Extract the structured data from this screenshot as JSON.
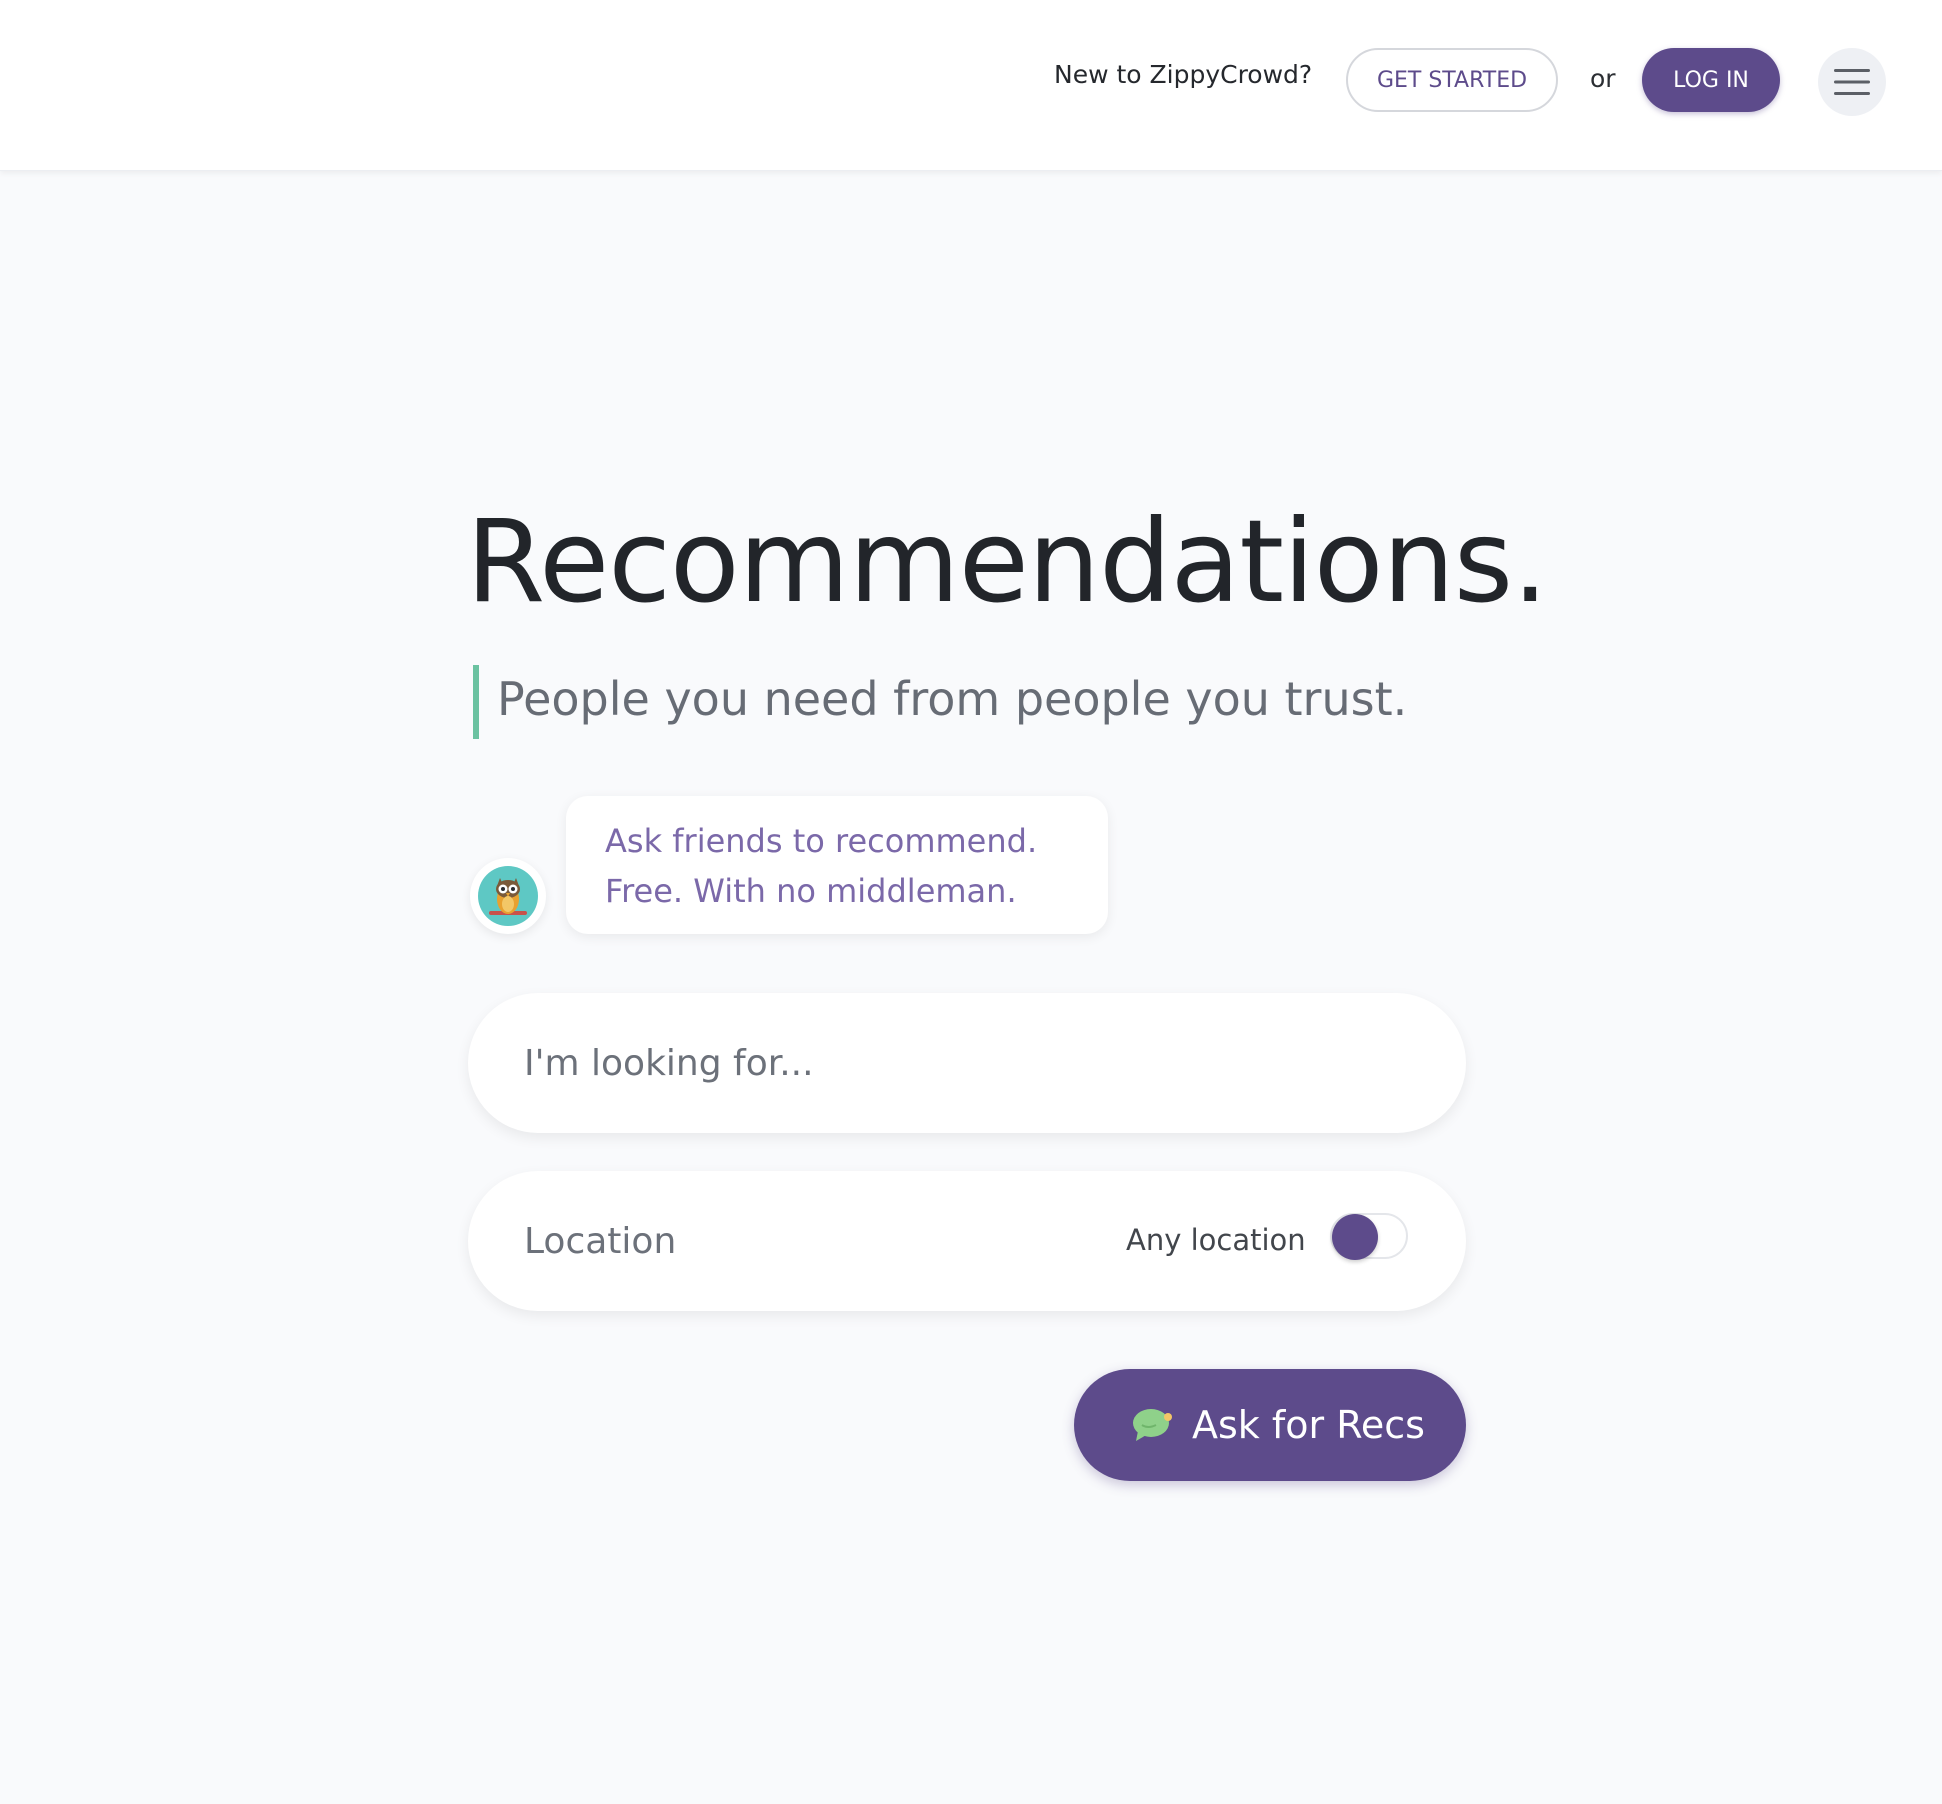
{
  "header": {
    "prompt_text": "New to ZippyCrowd?",
    "get_started_label": "GET STARTED",
    "or_text": "or",
    "login_label": "LOG IN",
    "menu_icon": "hamburger-menu-icon"
  },
  "hero": {
    "title": "Recommendations.",
    "subtitle": "People you need from people you trust."
  },
  "bot_message": {
    "avatar_icon": "owl-icon",
    "line1": "Ask friends to recommend.",
    "line2": "Free. With no middleman."
  },
  "search": {
    "placeholder": "I'm looking for...",
    "value": ""
  },
  "location": {
    "placeholder": "Location",
    "value": "",
    "any_location_label": "Any location",
    "any_location_enabled": true
  },
  "cta": {
    "icon": "speech-bubble-icon",
    "label": "Ask for Recs"
  },
  "colors": {
    "brand_purple": "#5d4b8b",
    "accent_green": "#6bc2a1",
    "bubble_text": "#7b69a9",
    "page_background": "#f9fafc"
  }
}
